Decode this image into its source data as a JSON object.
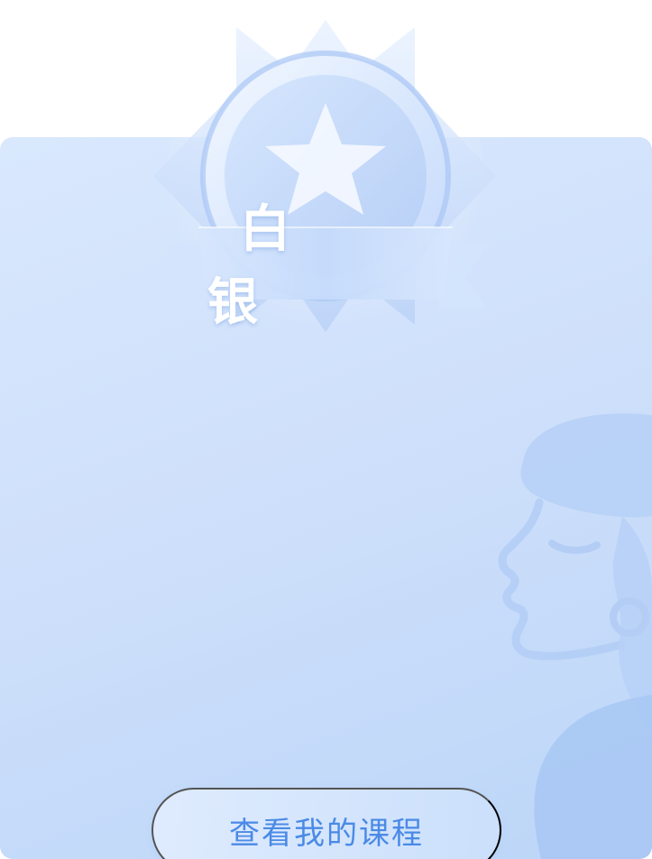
{
  "badge": {
    "level_label": "白 银",
    "icon": "star-medal-icon"
  },
  "actions": {
    "view_courses_label": "查看我的课程"
  },
  "decoration": {
    "icon": "woman-profile-illustration"
  },
  "colors": {
    "card_top": "#d9e8fd",
    "card_bottom": "#bcd6f8",
    "button_text": "#4a8ae6",
    "badge_light": "#e8f1ff",
    "badge_mid": "#b9d3fa"
  }
}
